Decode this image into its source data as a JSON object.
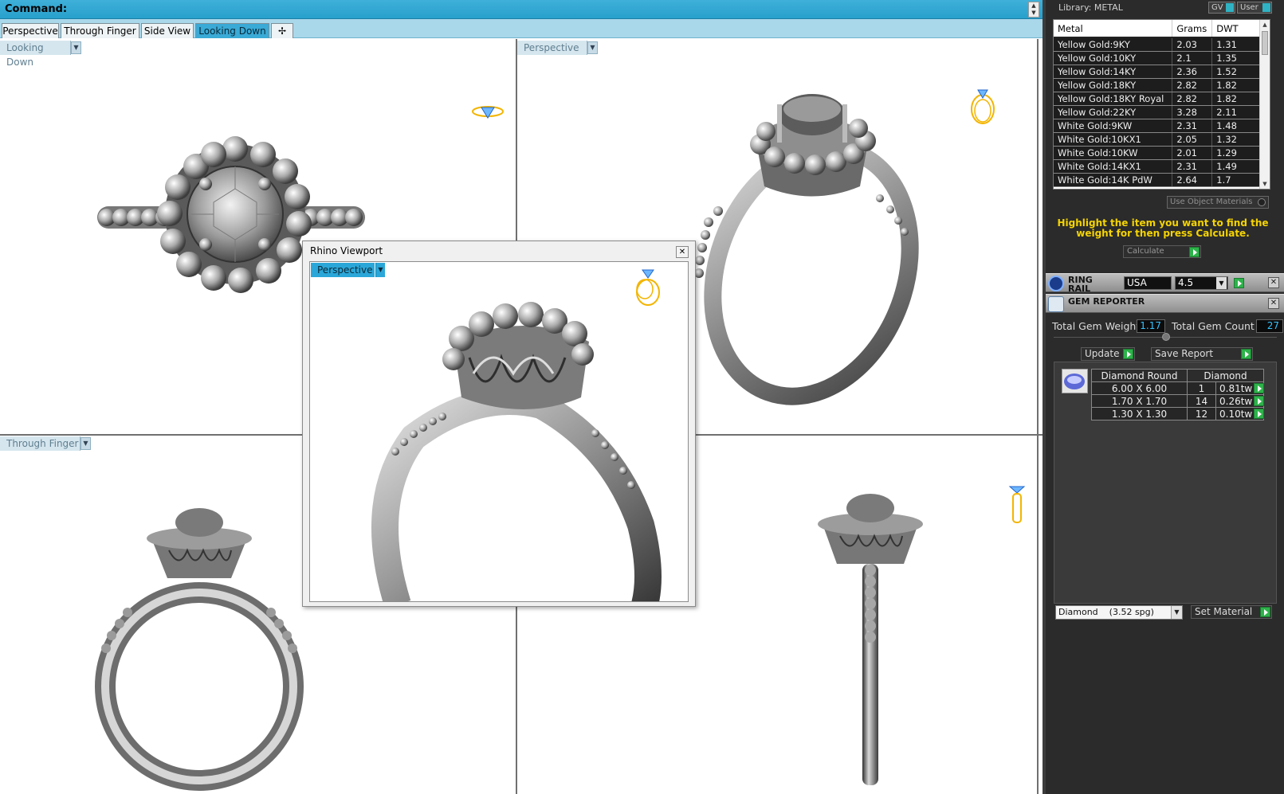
{
  "command": {
    "label": "Command:"
  },
  "viewport_tabs": [
    {
      "label": "Perspective",
      "active": false
    },
    {
      "label": "Through Finger",
      "active": false
    },
    {
      "label": "Side View",
      "active": false
    },
    {
      "label": "Looking Down",
      "active": true
    }
  ],
  "viewports": {
    "top_left": {
      "label": "Looking Down"
    },
    "top_right": {
      "label": "Perspective"
    },
    "bottom_left": {
      "label": "Through Finger"
    }
  },
  "floating_viewport": {
    "title": "Rhino Viewport",
    "viewport_label": "Perspective"
  },
  "library": {
    "label": "Library: METAL",
    "gv_label": "GV",
    "user_label": "User",
    "columns": [
      "Metal",
      "Grams",
      "DWT"
    ],
    "rows": [
      [
        "Yellow Gold:9KY",
        "2.03",
        "1.31"
      ],
      [
        "Yellow Gold:10KY",
        "2.1",
        "1.35"
      ],
      [
        "Yellow Gold:14KY",
        "2.36",
        "1.52"
      ],
      [
        "Yellow Gold:18KY",
        "2.82",
        "1.82"
      ],
      [
        "Yellow Gold:18KY Royal",
        "2.82",
        "1.82"
      ],
      [
        "Yellow Gold:22KY",
        "3.28",
        "2.11"
      ],
      [
        "White Gold:9KW",
        "2.31",
        "1.48"
      ],
      [
        "White Gold:10KX1",
        "2.05",
        "1.32"
      ],
      [
        "White Gold:10KW",
        "2.01",
        "1.29"
      ],
      [
        "White Gold:14KX1",
        "2.31",
        "1.49"
      ],
      [
        "White Gold:14K PdW",
        "2.64",
        "1.7"
      ]
    ],
    "use_object_materials": "Use Object Materials",
    "instruction": "Highlight the item you want to find the weight for then press Calculate.",
    "calculate_label": "Calculate"
  },
  "ring_rail": {
    "title_line1": "RING",
    "title_line2": "RAIL",
    "country": "USA",
    "size": "4.5"
  },
  "gem_reporter": {
    "title": "GEM REPORTER",
    "total_weight_label": "Total Gem Weight",
    "total_weight_value": "1.17",
    "total_count_label": "Total Gem Count",
    "total_count_value": "27",
    "update_label": "Update",
    "save_report_label": "Save Report",
    "gem_table": {
      "headers": [
        "Diamond Round",
        "Diamond"
      ],
      "rows": [
        [
          "6.00 X 6.00",
          "1",
          "0.81tw"
        ],
        [
          "1.70 X 1.70",
          "14",
          "0.26tw"
        ],
        [
          "1.30 X 1.30",
          "12",
          "0.10tw"
        ]
      ]
    },
    "material_select": {
      "name": "Diamond",
      "sg": "(3.52 spg)"
    },
    "set_material_label": "Set Material"
  },
  "colors": {
    "command_bar": "#27a0cc",
    "active_tab": "#3aaad6",
    "panel_bg": "#2b2b2b",
    "instruction_yellow": "#f5d400",
    "gem_value_cyan": "#35c3ff",
    "go_green": "#2db34a"
  }
}
